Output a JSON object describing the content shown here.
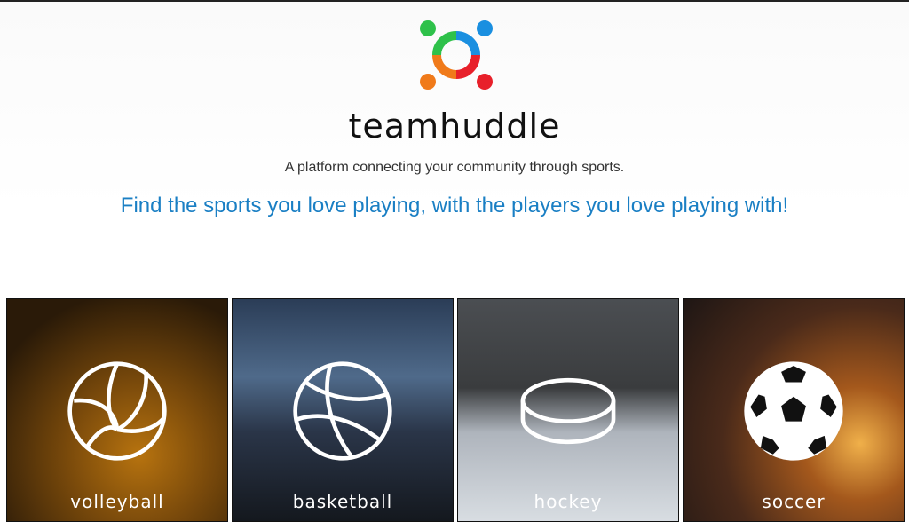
{
  "brand": {
    "name": "teamhuddle",
    "tagline": "A platform connecting your community through sports.",
    "headline": "Find the sports you love playing, with the players you love playing with!",
    "logo_colors": [
      "#2ec14a",
      "#1a8fe0",
      "#f07a1a",
      "#e8202a"
    ]
  },
  "sports": [
    {
      "label": "volleyball",
      "icon": "volleyball-icon"
    },
    {
      "label": "basketball",
      "icon": "basketball-icon"
    },
    {
      "label": "hockey",
      "icon": "hockey-puck-icon"
    },
    {
      "label": "soccer",
      "icon": "soccer-ball-icon"
    }
  ],
  "colors": {
    "headline": "#1a7fc4",
    "text": "#333333"
  }
}
